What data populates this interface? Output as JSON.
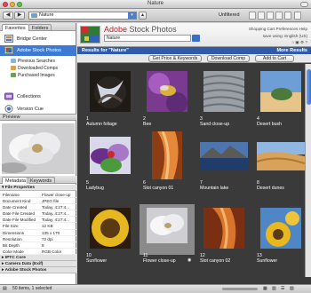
{
  "window": {
    "title": "Nature"
  },
  "toolbar": {
    "path_label": "Nature",
    "filter_label": "Unfiltered"
  },
  "left": {
    "tabs": [
      "Favorites",
      "Folders"
    ],
    "favorites": [
      "Bridge Center",
      "Adobe Stock Photos",
      "Collections",
      "Version Cue"
    ],
    "stock_sub": [
      "Previous Searches",
      "Downloaded Comps",
      "Purchased Images"
    ],
    "preview_title": "Preview",
    "meta_tabs": [
      "Metadata",
      "Keywords"
    ],
    "file_props_title": "File Properties",
    "file_props": [
      {
        "k": "Filename",
        "v": "Flower close-up"
      },
      {
        "k": "Document Kind",
        "v": "JPEG file"
      },
      {
        "k": "Date Created",
        "v": "Today, 4:27:4..."
      },
      {
        "k": "Date File Created",
        "v": "Today, 4:27:4..."
      },
      {
        "k": "Date File Modified",
        "v": "Today, 4:27:4..."
      },
      {
        "k": "File Size",
        "v": "12 KB"
      },
      {
        "k": "Dimensions",
        "v": "135 x 170"
      },
      {
        "k": "Resolution",
        "v": "72 dpi"
      },
      {
        "k": "Bit Depth",
        "v": "8"
      },
      {
        "k": "Color Mode",
        "v": "RGB Color"
      }
    ],
    "sections": [
      "IPTC Core",
      "Camera Data (Exif)",
      "Adobe Stock Photos"
    ]
  },
  "asp": {
    "title_red": "Adobe",
    "title_grey": "Stock Photos",
    "search_value": "Nature",
    "links_line1": "Shopping Cart  Preferences  Help",
    "links_line2": "save using: English (US)",
    "results_label": "Results for \"Nature\"",
    "more_results": "More Results",
    "buttons": [
      "Get Price & Keywords",
      "Download Comp",
      "Add to Cart"
    ]
  },
  "thumbs": [
    {
      "n": "1",
      "label": "Autumn foliage"
    },
    {
      "n": "2",
      "label": "Bee"
    },
    {
      "n": "3",
      "label": "Sand close-up"
    },
    {
      "n": "4",
      "label": "Desert bush"
    },
    {
      "n": "5",
      "label": "Ladybug"
    },
    {
      "n": "6",
      "label": "Slot canyon 01"
    },
    {
      "n": "7",
      "label": "Mountain lake"
    },
    {
      "n": "8",
      "label": "Desert dunes"
    },
    {
      "n": "10",
      "label": "Sunflower"
    },
    {
      "n": "11",
      "label": "Flower close-up"
    },
    {
      "n": "12",
      "label": "Slot canyon 02"
    },
    {
      "n": "13",
      "label": "Sunflower"
    }
  ],
  "status": {
    "text": "50 items, 1 selected"
  }
}
